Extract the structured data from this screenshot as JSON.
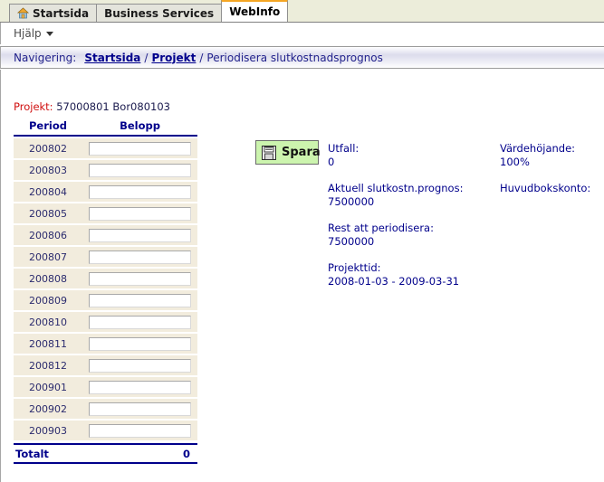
{
  "tabs": [
    {
      "label": "Startsida",
      "icon": "home-icon",
      "active": false
    },
    {
      "label": "Business Services",
      "icon": null,
      "active": false
    },
    {
      "label": "WebInfo",
      "icon": null,
      "active": true
    }
  ],
  "menu": {
    "help_label": "Hjälp",
    "caret_icon": "chevron-down-icon"
  },
  "breadcrumb": {
    "label": "Navigering:",
    "links": [
      {
        "text": "Startsida"
      },
      {
        "text": "Projekt"
      }
    ],
    "separator": "/",
    "current": "Periodisera slutkostnadsprognos"
  },
  "project": {
    "label": "Projekt:",
    "value": "57000801 Bor080103",
    "label_color": "#d01010"
  },
  "table": {
    "headers": {
      "period": "Period",
      "belopp": "Belopp"
    },
    "rows": [
      {
        "period": "200802",
        "belopp": ""
      },
      {
        "period": "200803",
        "belopp": ""
      },
      {
        "period": "200804",
        "belopp": ""
      },
      {
        "period": "200805",
        "belopp": ""
      },
      {
        "period": "200806",
        "belopp": ""
      },
      {
        "period": "200807",
        "belopp": ""
      },
      {
        "period": "200808",
        "belopp": ""
      },
      {
        "period": "200809",
        "belopp": ""
      },
      {
        "period": "200810",
        "belopp": ""
      },
      {
        "period": "200811",
        "belopp": ""
      },
      {
        "period": "200812",
        "belopp": ""
      },
      {
        "period": "200901",
        "belopp": ""
      },
      {
        "period": "200902",
        "belopp": ""
      },
      {
        "period": "200903",
        "belopp": ""
      }
    ],
    "total": {
      "label": "Totalt",
      "value": "0"
    }
  },
  "save_button": {
    "label": "Spara",
    "icon": "save-floppy-icon",
    "background": "#ccf4ae"
  },
  "info": {
    "left": [
      {
        "key": "Utfall:",
        "value": "0"
      },
      {
        "key": "Aktuell slutkostn.prognos:",
        "value": "7500000"
      },
      {
        "key": "Rest att periodisera:",
        "value": "7500000"
      },
      {
        "key": "Projekttid:",
        "value": "2008-01-03 - 2009-03-31"
      }
    ],
    "right": [
      {
        "key": "Värdehöjande:",
        "value": "100%"
      },
      {
        "key": "Huvudbokskonto:",
        "value": ""
      }
    ]
  },
  "theme": {
    "accent_orange": "#f5a623",
    "navy": "#00008b",
    "row_beige": "#f2ecdd",
    "tabbar_bg": "#ecedda"
  }
}
